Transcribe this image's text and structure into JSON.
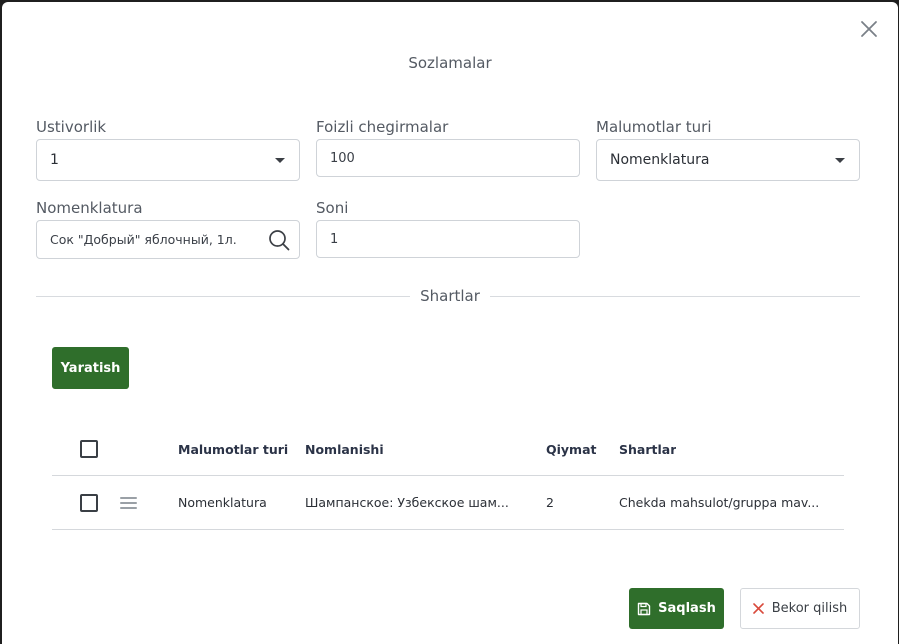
{
  "dialog": {
    "title": "Sozlamalar"
  },
  "form": {
    "priority": {
      "label": "Ustivorlik",
      "value": "1"
    },
    "discount": {
      "label": "Foizli chegirmalar",
      "value": "100"
    },
    "data_type": {
      "label": "Malumotlar turi",
      "value": "Nomenklatura"
    },
    "nomenclature": {
      "label": "Nomenklatura",
      "value": "Сок \"Добрый\" яблочный, 1л."
    },
    "count": {
      "label": "Soni",
      "value": "1"
    }
  },
  "conditions": {
    "section_title": "Shartlar",
    "create_label": "Yaratish",
    "columns": [
      "Malumotlar turi",
      "Nomlanishi",
      "Qiymat",
      "Shartlar"
    ],
    "rows": [
      {
        "data_type": "Nomenklatura",
        "name": "Шампанское: Узбекское шам...",
        "value": "2",
        "condition": "Chekda mahsulot/gruppa mav..."
      }
    ]
  },
  "footer": {
    "save_label": "Saqlash",
    "cancel_label": "Bekor qilish"
  },
  "colors": {
    "primary": "#2f6e2b",
    "cancel_icon": "#d94a3c"
  }
}
